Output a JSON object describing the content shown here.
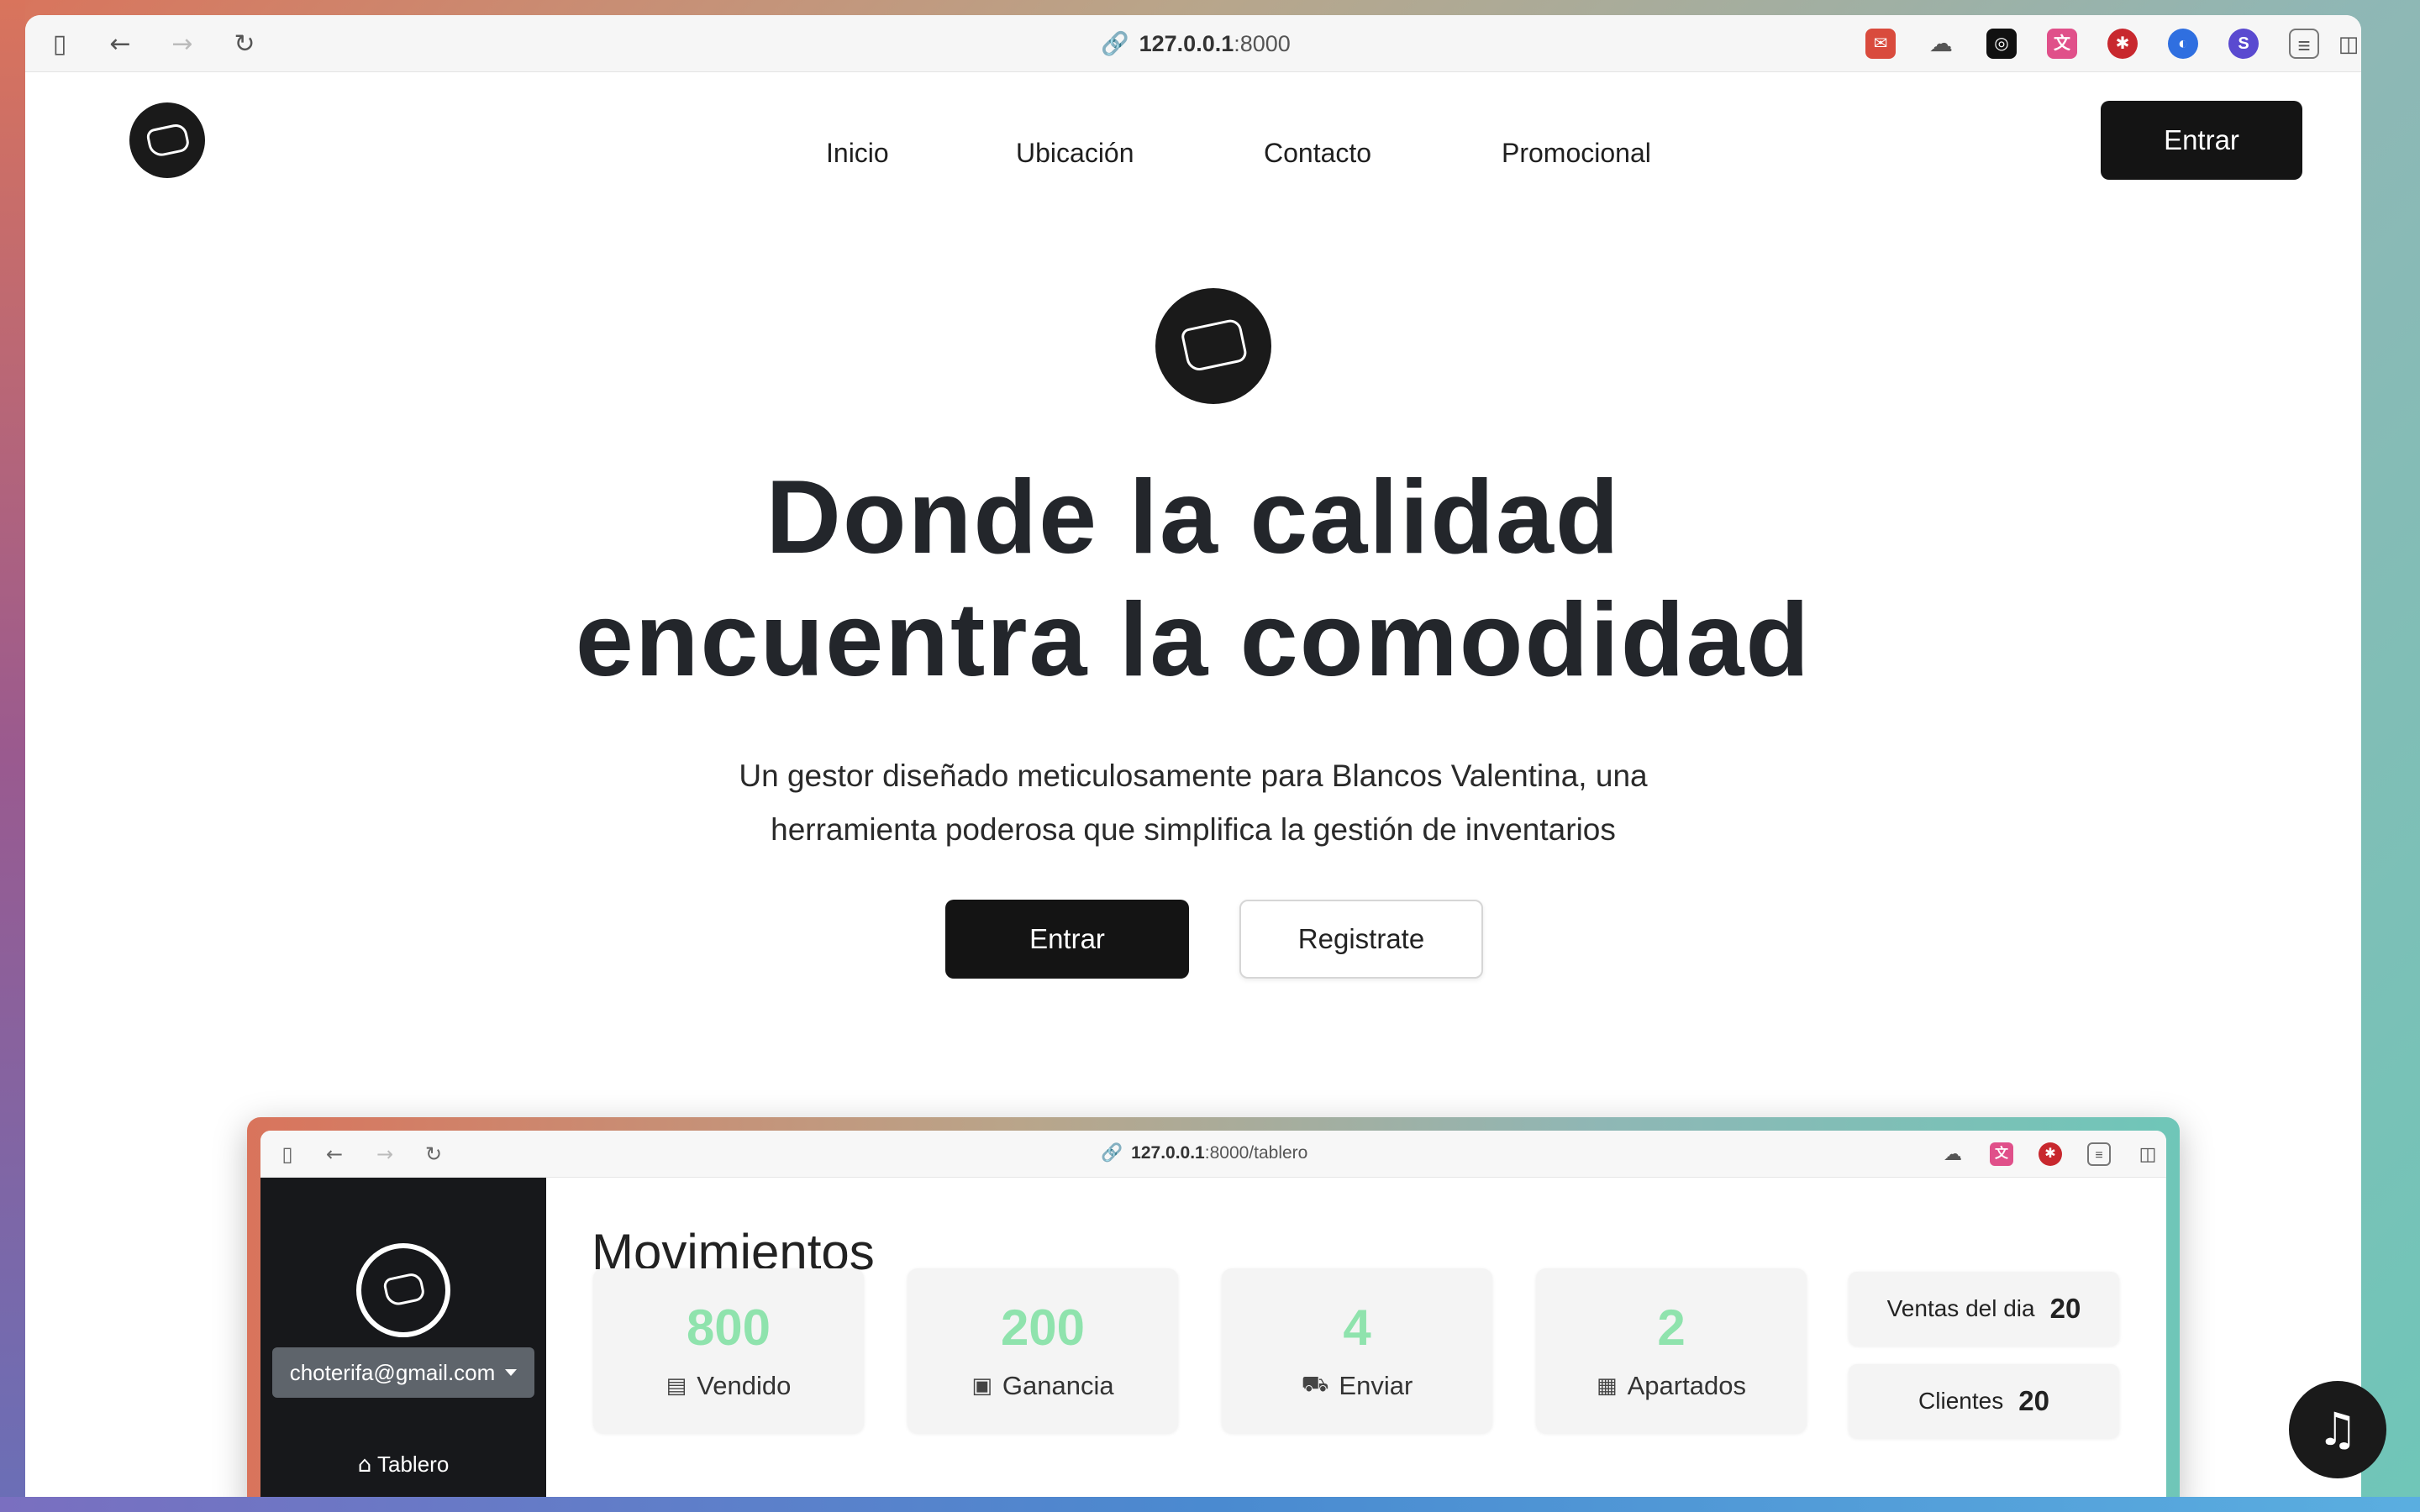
{
  "browser": {
    "url_host": "127.0.0.1",
    "url_port": ":8000"
  },
  "nav": {
    "links": [
      "Inicio",
      "Ubicación",
      "Contacto",
      "Promocional"
    ],
    "login_label": "Entrar"
  },
  "hero": {
    "title_line1": "Donde la calidad",
    "title_line2": "encuentra la comodidad",
    "subtitle_line1": "Un gestor diseñado meticulosamente para Blancos Valentina, una",
    "subtitle_line2": "herramienta poderosa que simplifica la gestión de inventarios",
    "primary_label": "Entrar",
    "secondary_label": "Registrate"
  },
  "preview": {
    "url_host": "127.0.0.1",
    "url_path": ":8000/tablero",
    "user_email": "choterifa@gmail.com",
    "sidebar_item": "Tablero",
    "title": "Movimientos",
    "cards": [
      {
        "value": "800",
        "label": "Vendido",
        "icon": "receipt-icon"
      },
      {
        "value": "200",
        "label": "Ganancia",
        "icon": "cash-icon"
      },
      {
        "value": "4",
        "label": "Enviar",
        "icon": "truck-icon"
      },
      {
        "value": "2",
        "label": "Apartados",
        "icon": "calendar-icon"
      }
    ],
    "mini_stats": [
      {
        "label": "Ventas del dia",
        "value": "20"
      },
      {
        "label": "Clientes",
        "value": "20"
      }
    ]
  },
  "colors": {
    "accent_green": "#8fe3ad",
    "dark": "#141414"
  }
}
